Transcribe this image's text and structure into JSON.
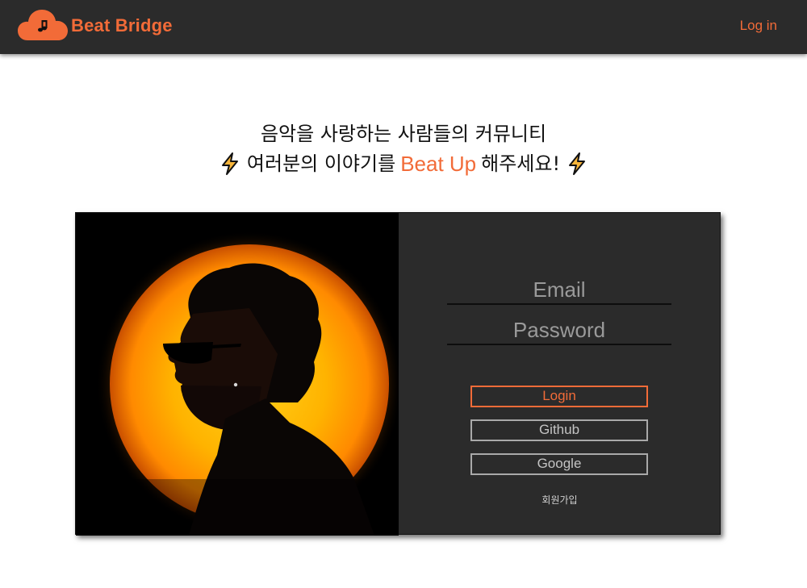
{
  "header": {
    "brand": "Beat Bridge",
    "login_link": "Log in",
    "logo_icon": "cloud-music-note-icon"
  },
  "hero": {
    "line1": "음악을 사랑하는 사람들의 커뮤니티",
    "line2_before": "여러분의 이야기를",
    "line2_highlight": "Beat Up",
    "line2_after": "해주세요!",
    "decor_icon": "lightning-bolt-icon"
  },
  "login_card": {
    "image": "artist-silhouette-photo",
    "email_placeholder": "Email",
    "password_placeholder": "Password",
    "login_button": "Login",
    "github_button": "Github",
    "google_button": "Google",
    "signup_link": "회원가입"
  },
  "colors": {
    "accent": "#f26b38",
    "header_bg": "#2b2b2b",
    "card_bg": "#2b2b2b"
  }
}
